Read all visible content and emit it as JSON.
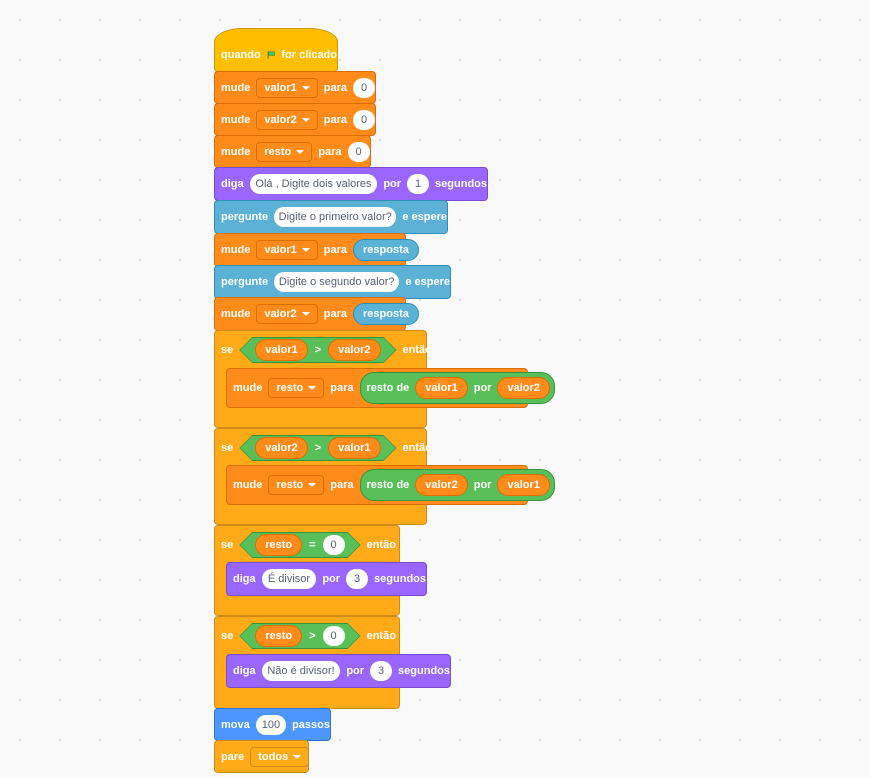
{
  "hat": {
    "when": "quando",
    "clicked": "for clicado",
    "flag_icon": "green-flag-icon"
  },
  "set_valor1": {
    "label": "mude",
    "var": "valor1",
    "to": "para",
    "value": "0"
  },
  "set_valor2": {
    "label": "mude",
    "var": "valor2",
    "to": "para",
    "value": "0"
  },
  "set_resto": {
    "label": "mude",
    "var": "resto",
    "to": "para",
    "value": "0"
  },
  "say1": {
    "label": "diga",
    "text": "Olá , Digite dois valores",
    "for": "por",
    "secs": "1",
    "unit": "segundos"
  },
  "ask1": {
    "label": "pergunte",
    "text": "Digite o primeiro valor?",
    "wait": "e espere"
  },
  "set_v1_answer": {
    "label": "mude",
    "var": "valor1",
    "to": "para",
    "value": "resposta"
  },
  "ask2": {
    "label": "pergunte",
    "text": "Digite o segundo valor?",
    "wait": "e espere"
  },
  "set_v2_answer": {
    "label": "mude",
    "var": "valor2",
    "to": "para",
    "value": "resposta"
  },
  "if1": {
    "if": "se",
    "then": "então",
    "left": "valor1",
    "op": ">",
    "right": "valor2",
    "inner": {
      "label": "mude",
      "var": "resto",
      "to": "para",
      "mod": "resto de",
      "a": "valor1",
      "by": "por",
      "b": "valor2"
    }
  },
  "if2": {
    "if": "se",
    "then": "então",
    "left": "valor2",
    "op": ">",
    "right": "valor1",
    "inner": {
      "label": "mude",
      "var": "resto",
      "to": "para",
      "mod": "resto de",
      "a": "valor2",
      "by": "por",
      "b": "valor1"
    }
  },
  "if3": {
    "if": "se",
    "then": "então",
    "left": "resto",
    "op": "=",
    "right": "0",
    "inner": {
      "label": "diga",
      "text": "É divisor",
      "for": "por",
      "secs": "3",
      "unit": "segundos"
    }
  },
  "if4": {
    "if": "se",
    "then": "então",
    "left": "resto",
    "op": ">",
    "right": "0",
    "inner": {
      "label": "diga",
      "text": "Não é divisor!",
      "for": "por",
      "secs": "3",
      "unit": "segundos"
    }
  },
  "move": {
    "label": "mova",
    "steps": "100",
    "unit": "passos"
  },
  "stop": {
    "label": "pare",
    "option": "todos"
  },
  "colors": {
    "motion": "#4c97ff",
    "events": "#ffbf00",
    "control": "#ffab19",
    "looks": "#9966ff",
    "sensing": "#5cb1d6",
    "variables": "#ff8c1a",
    "operators": "#59c059"
  }
}
